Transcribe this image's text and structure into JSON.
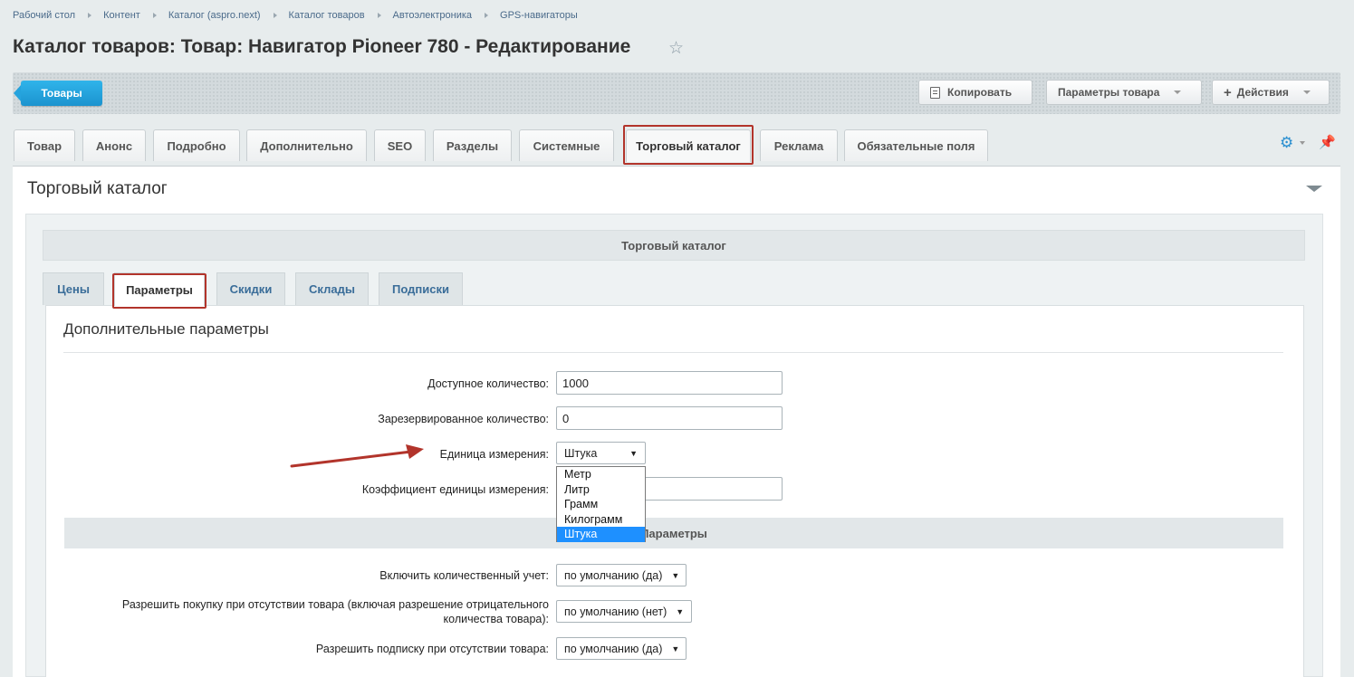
{
  "breadcrumbs": [
    "Рабочий стол",
    "Контент",
    "Каталог (aspro.next)",
    "Каталог товаров",
    "Автоэлектроника",
    "GPS-навигаторы"
  ],
  "page_title": "Каталог товаров: Товар: Навигатор Pioneer 780 - Редактирование",
  "toolbar": {
    "products_label": "Товары",
    "copy_label": "Копировать",
    "params_label": "Параметры товара",
    "actions_label": "Действия"
  },
  "tabs": [
    {
      "label": "Товар"
    },
    {
      "label": "Анонс"
    },
    {
      "label": "Подробно"
    },
    {
      "label": "Дополнительно"
    },
    {
      "label": "SEO"
    },
    {
      "label": "Разделы"
    },
    {
      "label": "Системные"
    },
    {
      "label": "Торговый каталог",
      "active": true
    },
    {
      "label": "Реклама"
    },
    {
      "label": "Обязательные поля"
    }
  ],
  "section": {
    "title": "Торговый каталог",
    "panel_header": "Торговый каталог"
  },
  "subtabs": [
    {
      "label": "Цены"
    },
    {
      "label": "Параметры",
      "active": true
    },
    {
      "label": "Скидки"
    },
    {
      "label": "Склады"
    },
    {
      "label": "Подписки"
    }
  ],
  "extra_params": {
    "title": "Дополнительные параметры",
    "available_qty_label": "Доступное количество:",
    "available_qty_value": "1000",
    "reserved_qty_label": "Зарезервированное количество:",
    "reserved_qty_value": "0",
    "unit_label": "Единица измерения:",
    "unit_value": "Штука",
    "unit_options": [
      "Метр",
      "Литр",
      "Грамм",
      "Килограмм",
      "Штука"
    ],
    "unit_selected_index": 4,
    "coef_label": "Коэффициент единицы измерения:",
    "coef_value": ""
  },
  "params": {
    "header": "Параметры",
    "qty_trace_label": "Включить количественный учет:",
    "qty_trace_value": "по умолчанию (да)",
    "can_buy_zero_label_1": "Разрешить покупку при отсутствии товара (включая разрешение отрицательного",
    "can_buy_zero_label_2": "количества товара):",
    "can_buy_zero_value": "по умолчанию (нет)",
    "subscribe_label": "Разрешить подписку при отсутствии товара:",
    "subscribe_value": "по умолчанию (да)"
  },
  "colors": {
    "accent": "#1b93cf",
    "highlight": "#b2342b"
  }
}
